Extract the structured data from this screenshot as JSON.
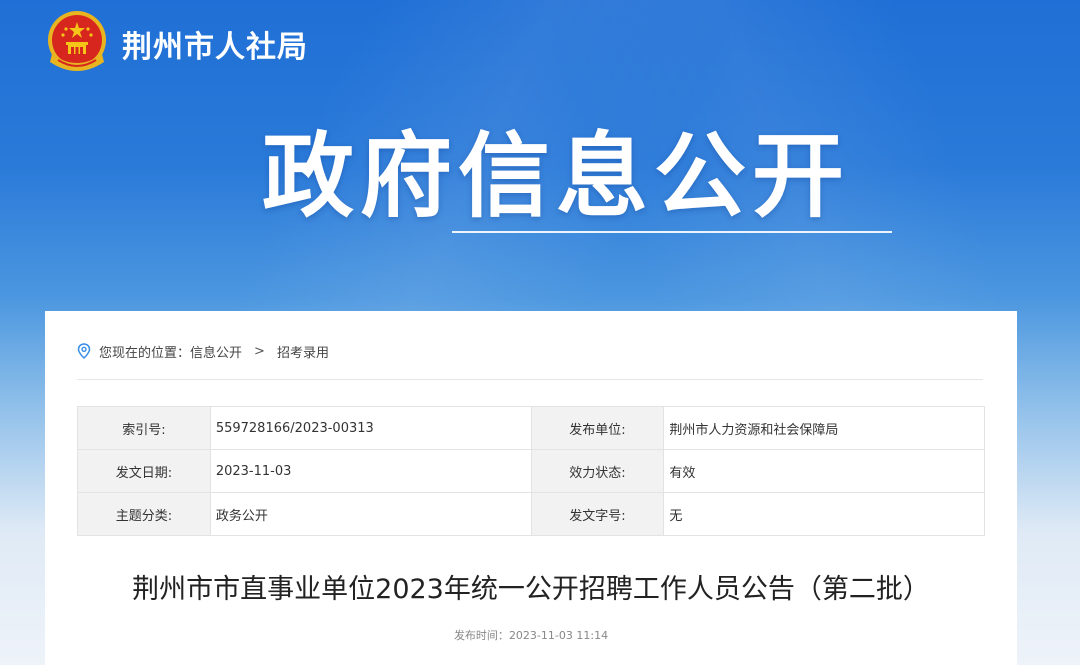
{
  "header": {
    "site_name": "荆州市人社局",
    "hero_title": "政府信息公开"
  },
  "breadcrumb": {
    "prefix": "您现在的位置：",
    "items": [
      "信息公开",
      "招考录用"
    ],
    "separator": ">"
  },
  "meta_table": {
    "rows": [
      {
        "k1": "索引号:",
        "v1": "559728166/2023-00313",
        "k2": "发布单位:",
        "v2": "荆州市人力资源和社会保障局"
      },
      {
        "k1": "发文日期:",
        "v1": "2023-11-03",
        "k2": "效力状态:",
        "v2": "有效"
      },
      {
        "k1": "主题分类:",
        "v1": "政务公开",
        "k2": "发文字号:",
        "v2": "无"
      }
    ]
  },
  "article": {
    "title": "荆州市市直事业单位2023年统一公开招聘工作人员公告（第二批）",
    "publish_label": "发布时间：",
    "publish_time": "2023-11-03 11:14"
  },
  "colors": {
    "banner_blue": "#1f6fd6",
    "emblem_red": "#d7261e",
    "emblem_gold": "#f5c518"
  },
  "icons": {
    "emblem": "national-emblem-icon",
    "location": "location-pin-icon"
  }
}
